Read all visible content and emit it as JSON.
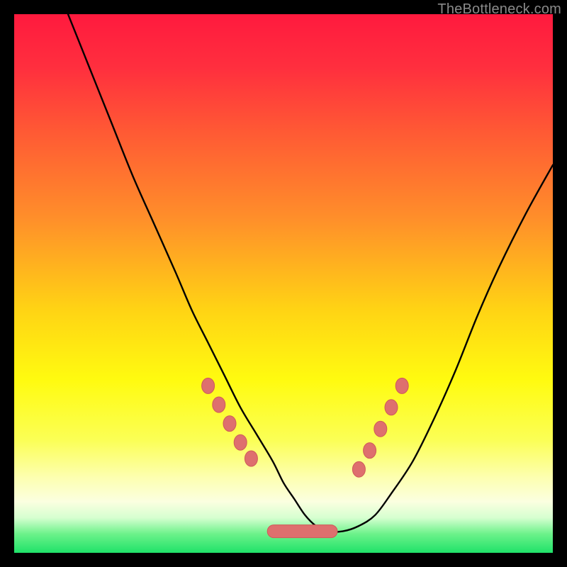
{
  "watermark": "TheBottleneck.com",
  "colors": {
    "frame_bg": "#000000",
    "gradient_stops": [
      {
        "offset": 0.0,
        "color": "#ff1a3e"
      },
      {
        "offset": 0.1,
        "color": "#ff2f3e"
      },
      {
        "offset": 0.22,
        "color": "#ff5a34"
      },
      {
        "offset": 0.38,
        "color": "#ff8f2a"
      },
      {
        "offset": 0.55,
        "color": "#ffd414"
      },
      {
        "offset": 0.68,
        "color": "#fffb10"
      },
      {
        "offset": 0.79,
        "color": "#fbff55"
      },
      {
        "offset": 0.86,
        "color": "#fdffb0"
      },
      {
        "offset": 0.905,
        "color": "#fbffe0"
      },
      {
        "offset": 0.935,
        "color": "#d6ffd0"
      },
      {
        "offset": 0.965,
        "color": "#6cf28a"
      },
      {
        "offset": 1.0,
        "color": "#1fe269"
      }
    ],
    "curve_stroke": "#000000",
    "marker_fill": "#de6f6e",
    "marker_stroke": "#cf5a59"
  },
  "chart_data": {
    "type": "line",
    "title": "",
    "xlabel": "",
    "ylabel": "",
    "xlim": [
      0,
      100
    ],
    "ylim": [
      0,
      100
    ],
    "grid": false,
    "legend": false,
    "description": "Bottleneck severity curve. X = hardware balance index (left skewed toward one component, right toward the other). Y = bottleneck severity percent (0 at bottom = no bottleneck / green, 100 at top = full bottleneck / red).",
    "curve": {
      "name": "bottleneck_severity",
      "x": [
        10,
        14,
        18,
        22,
        26,
        30,
        33,
        36,
        39,
        42,
        45,
        48,
        50,
        52,
        54,
        56,
        58,
        61,
        64,
        67,
        70,
        74,
        78,
        82,
        86,
        90,
        95,
        100
      ],
      "y": [
        100,
        90,
        80,
        70,
        61,
        52,
        45,
        39,
        33,
        27,
        22,
        17,
        13,
        10,
        7,
        5,
        4,
        4,
        5,
        7,
        11,
        17,
        25,
        34,
        44,
        53,
        63,
        72
      ]
    },
    "markers_left": {
      "comment": "highlighted points descending left flank (salmon dots)",
      "x": [
        36,
        38,
        40,
        42,
        44
      ],
      "y": [
        31,
        27.5,
        24,
        20.5,
        17.5
      ]
    },
    "markers_right": {
      "comment": "highlighted points ascending right flank (salmon dots)",
      "x": [
        64,
        66,
        68,
        70,
        72
      ],
      "y": [
        15.5,
        19,
        23,
        27,
        31
      ]
    },
    "plateau": {
      "comment": "wide salmon bar marking the optimal (no bottleneck) zone",
      "x": [
        47,
        60
      ],
      "y": 4
    }
  }
}
